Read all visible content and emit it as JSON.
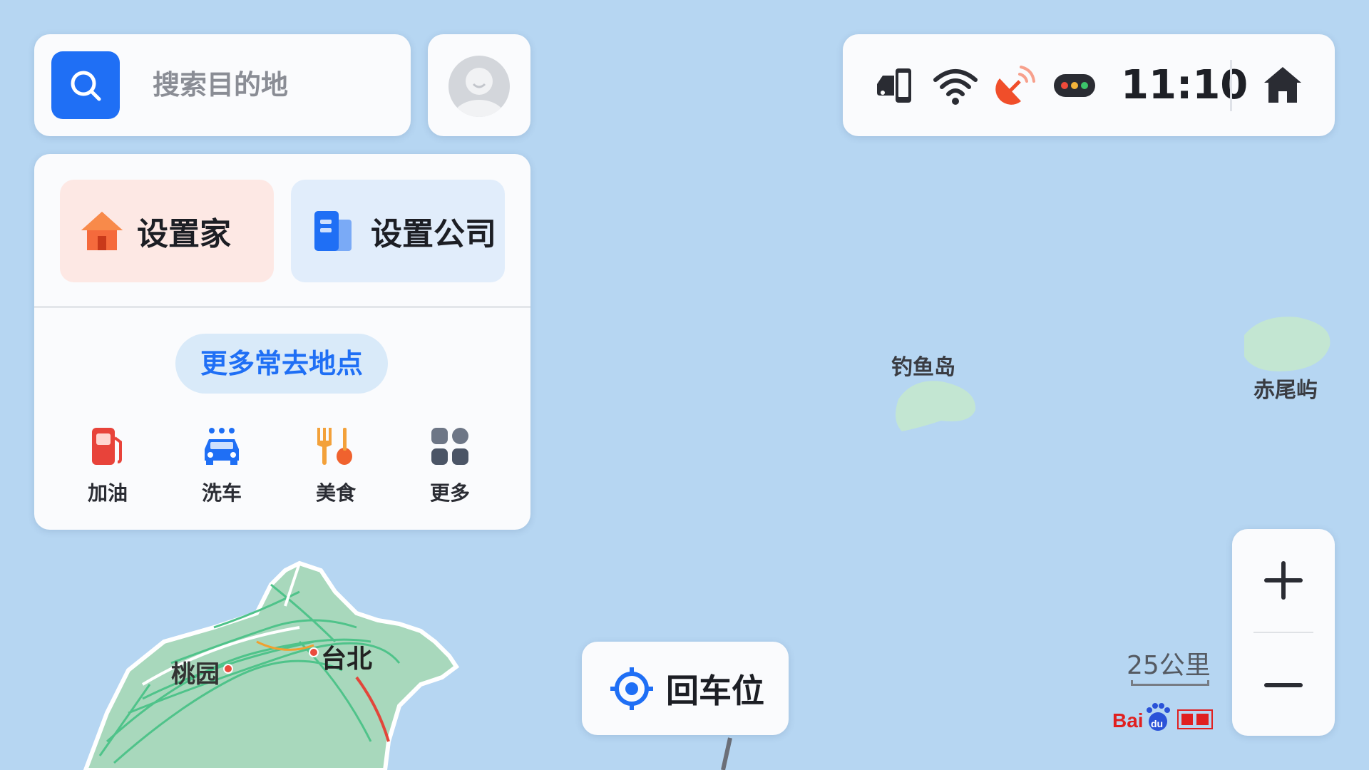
{
  "search": {
    "placeholder": "搜索目的地"
  },
  "status": {
    "time": "11:10"
  },
  "quick": {
    "home_label": "设置家",
    "company_label": "设置公司",
    "more_places_label": "更多常去地点",
    "categories": [
      {
        "label": "加油",
        "icon": "gas-station-icon"
      },
      {
        "label": "洗车",
        "icon": "car-wash-icon"
      },
      {
        "label": "美食",
        "icon": "food-icon"
      },
      {
        "label": "更多",
        "icon": "grid-more-icon"
      }
    ]
  },
  "map": {
    "labels": {
      "diaoyu": "钓鱼岛",
      "chiwei": "赤尾屿",
      "taipei": "台北",
      "taoyuan": "桃园"
    },
    "scale": "25公里"
  },
  "return_car": {
    "label": "回车位"
  },
  "colors": {
    "accent": "#1f6ff5",
    "map_water": "#b6d6f2",
    "land": "#a8d8bc"
  }
}
